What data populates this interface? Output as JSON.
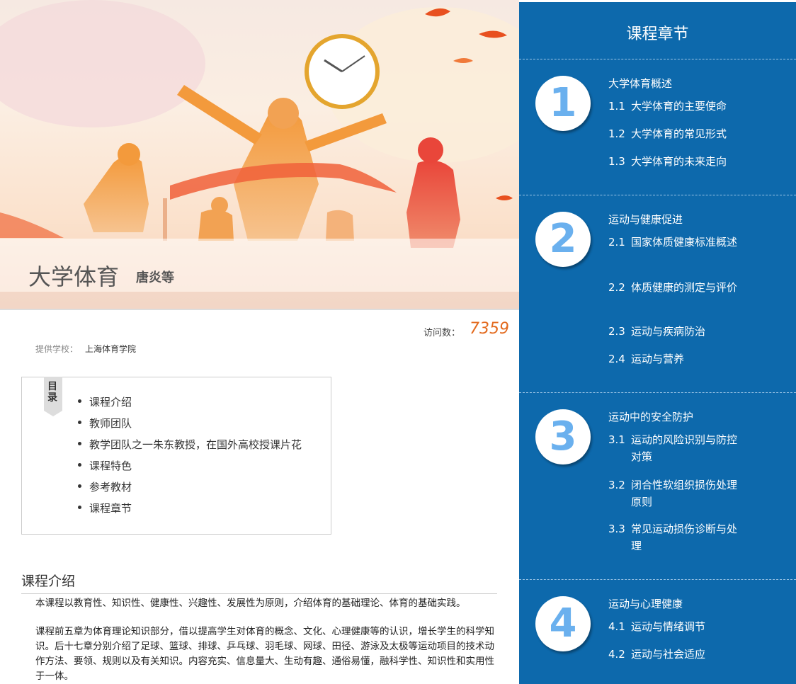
{
  "banner": {
    "course_title": "大学体育",
    "course_author": "唐炎等"
  },
  "stats": {
    "visits_label": "访问数：",
    "visits_count": "7359"
  },
  "school": {
    "label": "提供学校：",
    "name": "上海体育学院"
  },
  "toc": {
    "tag": "目录",
    "items": [
      "课程介绍",
      "教师团队",
      "教学团队之一朱东教授，在国外高校授课片花",
      "课程特色",
      "参考教材",
      "课程章节"
    ]
  },
  "intro": {
    "title": "课程介绍",
    "p1": "本课程以教育性、知识性、健康性、兴趣性、发展性为原则，介绍体育的基础理论、体育的基础实践。",
    "p2": "课程前五章为体育理论知识部分，借以提高学生对体育的概念、文化、心理健康等的认识，增长学生的科学知识。后十七章分别介绍了足球、篮球、排球、乒乓球、羽毛球、网球、田径、游泳及太极等运动项目的技术动作方法、要领、规则以及有关知识。内容充实、信息量大、生动有趣、通俗易懂，融科学性、知识性和实用性于一体。"
  },
  "chapters": {
    "title": "课程章节",
    "list": [
      {
        "number": "1",
        "name": "大学体育概述",
        "sections": [
          {
            "num": "1.1",
            "title": "大学体育的主要使命"
          },
          {
            "num": "1.2",
            "title": "大学体育的常见形式"
          },
          {
            "num": "1.3",
            "title": "大学体育的未来走向"
          }
        ]
      },
      {
        "number": "2",
        "name": "运动与健康促进",
        "sections": [
          {
            "num": "2.1",
            "title": "国家体质健康标准概述"
          },
          {
            "num": "2.2",
            "title": "体质健康的测定与评价"
          },
          {
            "num": "2.3",
            "title": "运动与疾病防治"
          },
          {
            "num": "2.4",
            "title": "运动与营养"
          }
        ]
      },
      {
        "number": "3",
        "name": "运动中的安全防护",
        "sections": [
          {
            "num": "3.1",
            "title": "运动的风险识别与防控对策"
          },
          {
            "num": "3.2",
            "title": "闭合性软组织损伤处理原则"
          },
          {
            "num": "3.3",
            "title": "常见运动损伤诊断与处理"
          }
        ]
      },
      {
        "number": "4",
        "name": "运动与心理健康",
        "sections": [
          {
            "num": "4.1",
            "title": "运动与情绪调节"
          },
          {
            "num": "4.2",
            "title": "运动与社会适应"
          }
        ]
      }
    ]
  },
  "colors": {
    "sidebar_bg": "#0d69ac",
    "chapter_digit": "#6ab0ee",
    "visits_accent": "#e36a1e"
  }
}
